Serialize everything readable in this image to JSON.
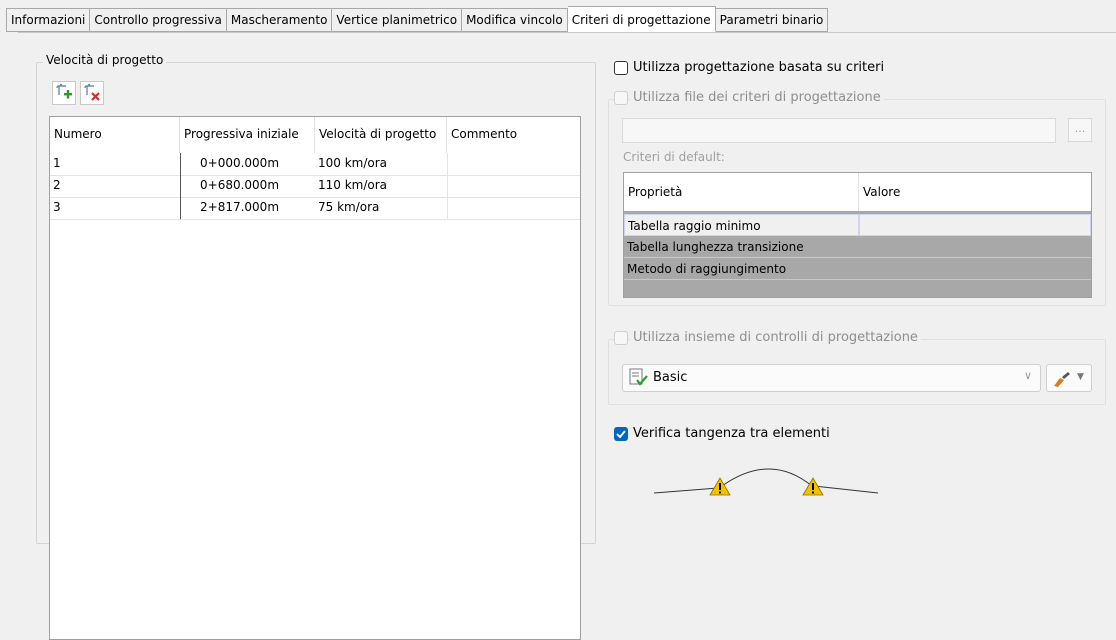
{
  "tabs": [
    {
      "label": "Informazioni"
    },
    {
      "label": "Controllo progressiva"
    },
    {
      "label": "Mascheramento"
    },
    {
      "label": "Vertice planimetrico"
    },
    {
      "label": "Modifica vincolo"
    },
    {
      "label": "Criteri di progettazione",
      "active": true
    },
    {
      "label": "Parametri binario"
    }
  ],
  "speeds": {
    "group_label": "Velocità di progetto",
    "add_icon": "add-row-icon",
    "delete_icon": "delete-row-icon",
    "columns": [
      "Numero",
      "Progressiva iniziale",
      "Velocità di progetto",
      "Commento"
    ],
    "rows": [
      {
        "num": "1",
        "station": "0+000.000m",
        "speed": "100 km/ora",
        "comment": ""
      },
      {
        "num": "2",
        "station": "0+680.000m",
        "speed": "110 km/ora",
        "comment": ""
      },
      {
        "num": "3",
        "station": "2+817.000m",
        "speed": "75 km/ora",
        "comment": ""
      }
    ]
  },
  "criteria": {
    "use_criteria_label": "Utilizza progettazione basata su criteri",
    "use_file_label": "Utilizza file dei criteri di progettazione",
    "browse_label": "...",
    "default_label": "Criteri di default:",
    "columns": [
      "Proprietà",
      "Valore"
    ],
    "rows": [
      "Tabella raggio minimo",
      "Tabella lunghezza transizione",
      "Metodo di raggiungimento"
    ]
  },
  "checks": {
    "use_checkset_label": "Utilizza insieme di controlli di progettazione",
    "checkset_value": "Basic",
    "tangency_label": "Verifica tangenza tra elementi"
  },
  "colors": {
    "accent": "#0067c0",
    "warning": "#f2c200"
  }
}
